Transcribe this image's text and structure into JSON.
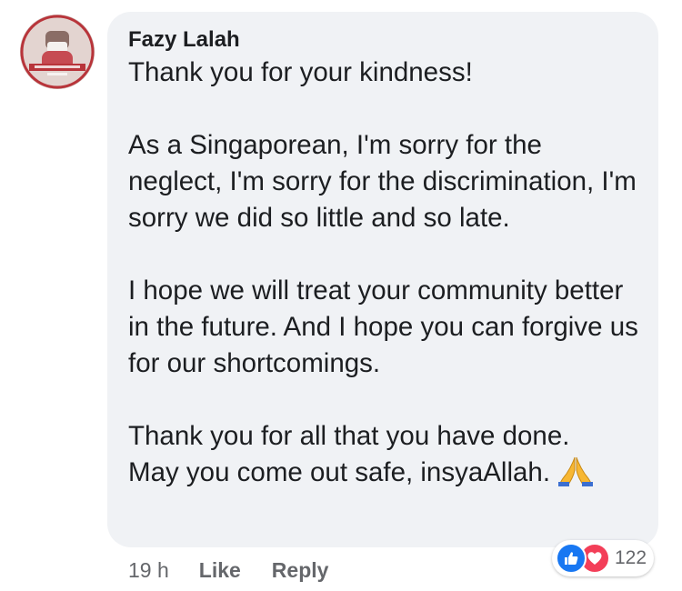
{
  "comment": {
    "author": "Fazy Lalah",
    "paragraphs": [
      "Thank you for your kindness!",
      "As a Singaporean, I'm sorry for the neglect, I'm sorry for the discrimination, I'm sorry we did so little and so late.",
      "I hope we will treat your community better in the future. And I hope you can forgive us for our shortcomings.",
      "Thank you for all that you have done.",
      "May you come out safe, insyaAllah."
    ],
    "trailing_emoji": "pray-icon"
  },
  "actions": {
    "time": "19 h",
    "like_label": "Like",
    "reply_label": "Reply"
  },
  "reactions": {
    "icons": [
      "like-icon",
      "love-icon"
    ],
    "count": "122"
  },
  "colors": {
    "bubble": "#f0f2f5",
    "text": "#1c1e21",
    "secondary": "#65676b",
    "like_blue": "#1877f2",
    "love_red": "#f33e58"
  }
}
